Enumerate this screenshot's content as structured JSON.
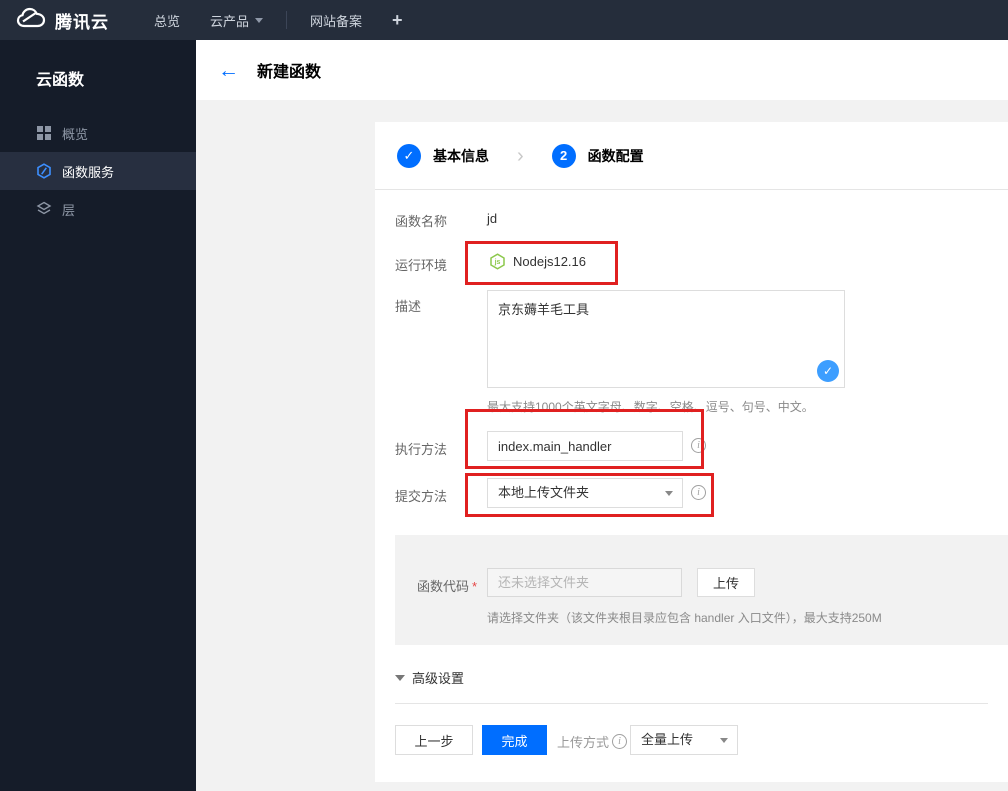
{
  "colors": {
    "primary_blue": "#006eff",
    "annotation_red": "#e02020",
    "node_green": "#8cc84b",
    "check_bubble_blue": "#3d9eff",
    "topbar_bg": "#252d3b",
    "sidebar_bg": "#151c29"
  },
  "topbar": {
    "brand": "腾讯云",
    "nav": [
      {
        "label": "总览"
      },
      {
        "label": "云产品"
      },
      {
        "label": "网站备案"
      },
      {
        "label": "+"
      }
    ]
  },
  "sidebar": {
    "title": "云函数",
    "items": [
      {
        "label": "概览",
        "icon": "grid-icon",
        "active": false
      },
      {
        "label": "函数服务",
        "icon": "scf-hexagon-icon",
        "active": true
      },
      {
        "label": "层",
        "icon": "layers-icon",
        "active": false
      }
    ]
  },
  "header": {
    "back_glyph": "←",
    "title": "新建函数"
  },
  "steps": {
    "step1": {
      "glyph": "✓",
      "label": "基本信息"
    },
    "separator": "›",
    "step2": {
      "number": "2",
      "label": "函数配置"
    }
  },
  "form": {
    "function_name": {
      "label": "函数名称",
      "value": "jd"
    },
    "runtime": {
      "label": "运行环境",
      "value": "Nodejs12.16",
      "icon": "nodejs-icon"
    },
    "description": {
      "label": "描述",
      "value": "京东薅羊毛工具",
      "helper": "最大支持1000个英文字母、数字、空格、逗号、句号、中文。",
      "valid_glyph": "✓"
    },
    "handler": {
      "label": "执行方法",
      "value": "index.main_handler"
    },
    "submit_method": {
      "label": "提交方法",
      "value": "本地上传文件夹"
    },
    "function_code": {
      "label": "函数代码",
      "required_mark": "*",
      "placeholder": "还未选择文件夹",
      "upload_button": "上传",
      "helper": "请选择文件夹（该文件夹根目录应包含 handler 入口文件），最大支持250M"
    },
    "advanced": {
      "label": "高级设置"
    }
  },
  "footer": {
    "prev": "上一步",
    "finish": "完成",
    "upload_mode_label": "上传方式",
    "upload_mode_value": "全量上传"
  }
}
